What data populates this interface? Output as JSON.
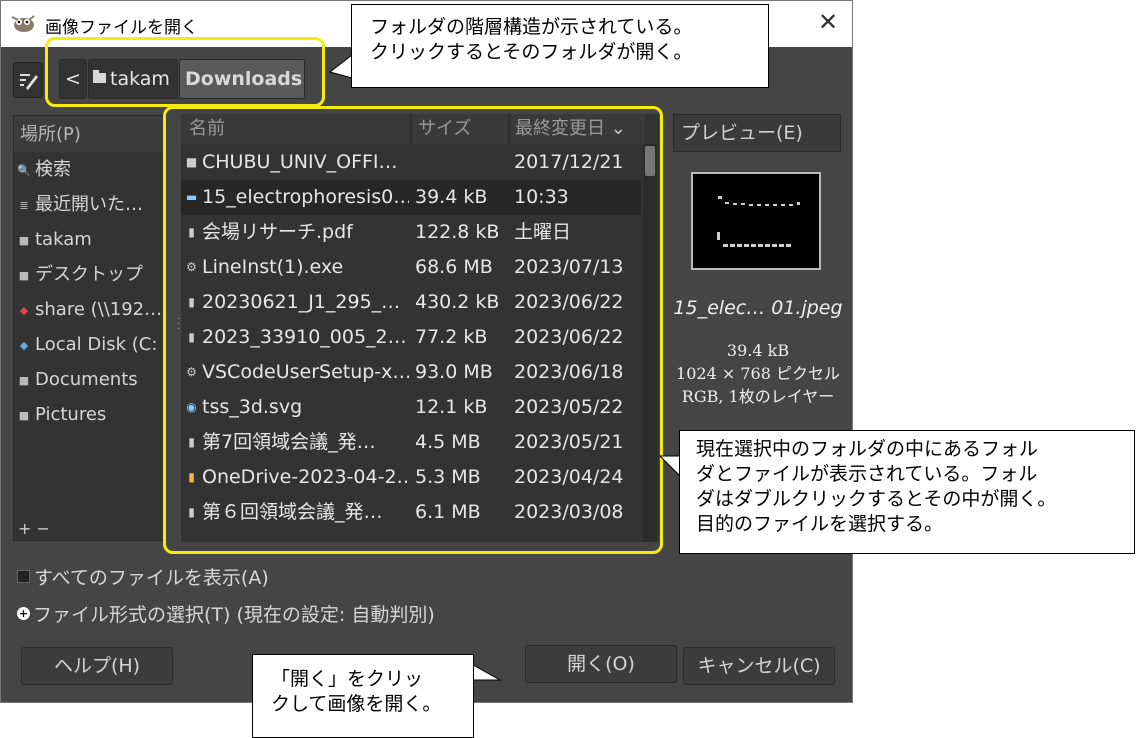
{
  "window": {
    "title": "画像ファイルを開く",
    "close_label": "✕"
  },
  "breadcrumb": {
    "back_label": "<",
    "items": [
      "takam",
      "Downloads"
    ]
  },
  "places": {
    "header": "場所(P)",
    "items": [
      {
        "label": "検索",
        "icon": "search-icon"
      },
      {
        "label": "最近開いた…",
        "icon": "recent-icon"
      },
      {
        "label": "takam",
        "icon": "folder-icon"
      },
      {
        "label": "デスクトップ",
        "icon": "folder-icon"
      },
      {
        "label": "share (\\\\192…",
        "icon": "network-drive-icon"
      },
      {
        "label": "Local Disk (C:",
        "icon": "disk-icon"
      },
      {
        "label": "Documents",
        "icon": "folder-icon"
      },
      {
        "label": "Pictures",
        "icon": "folder-icon"
      }
    ],
    "footer": "+ −"
  },
  "files": {
    "columns": {
      "name": "名前",
      "size": "サイズ",
      "date": "最終変更日"
    },
    "rows": [
      {
        "name": "CHUBU_UNIV_OFFI…",
        "size": "",
        "date": "2017/12/21",
        "icon": "folder-icon"
      },
      {
        "name": "15_electrophoresis0…",
        "size": "39.4 kB",
        "date": "10:33",
        "icon": "image-icon",
        "selected": true
      },
      {
        "name": "会場リサーチ.pdf",
        "size": "122.8 kB",
        "date": "土曜日",
        "icon": "document-icon"
      },
      {
        "name": "LineInst(1).exe",
        "size": "68.6 MB",
        "date": "2023/07/13",
        "icon": "executable-icon"
      },
      {
        "name": "20230621_J1_295_…",
        "size": "430.2 kB",
        "date": "2023/06/22",
        "icon": "document-icon"
      },
      {
        "name": "2023_33910_005_2…",
        "size": "77.2 kB",
        "date": "2023/06/22",
        "icon": "document-icon"
      },
      {
        "name": "VSCodeUserSetup-x…",
        "size": "93.0 MB",
        "date": "2023/06/18",
        "icon": "executable-icon"
      },
      {
        "name": "tss_3d.svg",
        "size": "12.1 kB",
        "date": "2023/05/22",
        "icon": "image-icon"
      },
      {
        "name": "第7回領域会議_発…",
        "size": "4.5 MB",
        "date": "2023/05/21",
        "icon": "document-icon"
      },
      {
        "name": "OneDrive-2023-04-2…",
        "size": "5.3 MB",
        "date": "2023/04/24",
        "icon": "archive-icon"
      },
      {
        "name": "第６回領域会議_発…",
        "size": "6.1 MB",
        "date": "2023/03/08",
        "icon": "document-icon"
      }
    ]
  },
  "preview": {
    "button_label": "プレビュー(E)",
    "filename": "15_elec… 01.jpeg",
    "filesize": "39.4 kB",
    "dimensions": "1024 × 768 ピクセル",
    "mode": "RGB, 1枚のレイヤー"
  },
  "options": {
    "show_all": "すべてのファイルを表示(A)",
    "file_type": "ファイル形式の選択(T) (現在の設定: 自動判別)"
  },
  "buttons": {
    "help": "ヘルプ(H)",
    "open": "開く(O)",
    "cancel": "キャンセル(C)"
  },
  "annotations": {
    "folder_path": [
      "フォルダの階層構造が示されている。",
      "クリックするとそのフォルダが開く。"
    ],
    "file_list": [
      "現在選択中のフォルダの中にあるフォル",
      "ダとファイルが表示されている。フォル",
      "ダはダブルクリックするとその中が開く。",
      "目的のファイルを選択する。"
    ],
    "open": [
      "「開く」をクリッ",
      "クして画像を開く。"
    ]
  },
  "colors": {
    "highlight": "#f5eb0c",
    "dialog_bg": "#454545",
    "panel_bg": "#333333"
  }
}
